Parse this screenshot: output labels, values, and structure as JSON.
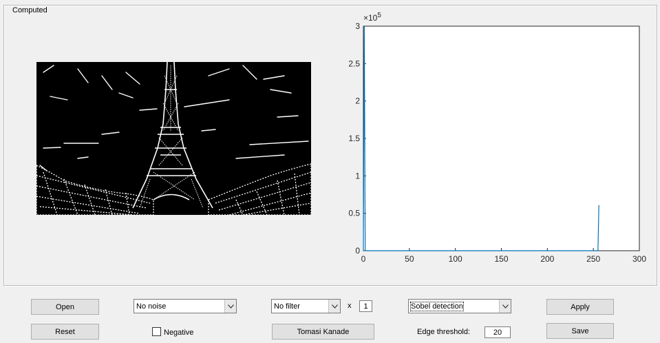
{
  "panel": {
    "title": "Computed"
  },
  "image": {
    "description_icon": "edge-map-image"
  },
  "chart_data": {
    "type": "line",
    "x": [
      0,
      1,
      2,
      3,
      254,
      255,
      256
    ],
    "y": [
      0,
      300000,
      0,
      0,
      0,
      0,
      61000
    ],
    "xlim": [
      0,
      300
    ],
    "ylim": [
      0,
      300000
    ],
    "xticks": [
      "0",
      "50",
      "100",
      "150",
      "200",
      "250",
      "300"
    ],
    "yticks": [
      "0",
      "0.5",
      "1",
      "1.5",
      "2",
      "2.5",
      "3"
    ],
    "exponent_base": "×10",
    "exponent_power": "5",
    "color": "#0072bd",
    "grid": false
  },
  "controls": {
    "open_label": "Open",
    "reset_label": "Reset",
    "noise_value": "No noise",
    "negative_label": "Negative",
    "filter_value": "No filter",
    "times_label": "x",
    "filter_count": "1",
    "tomasi_label": "Tomasi Kanade",
    "detection_value": "Sobel detection",
    "edge_threshold_label": "Edge threshold:",
    "edge_threshold_value": "20",
    "apply_label": "Apply",
    "save_label": "Save"
  }
}
